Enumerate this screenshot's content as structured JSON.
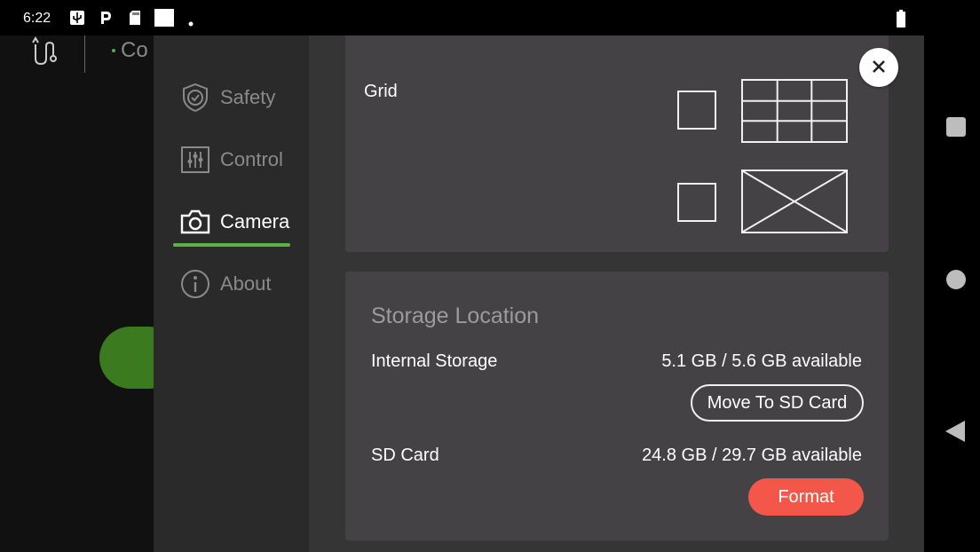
{
  "status_bar": {
    "time": "6:22",
    "icons": [
      "usb-icon",
      "parking-icon",
      "sd-card-icon",
      "notification-square-icon",
      "dot-icon"
    ],
    "battery_icon": "battery-icon"
  },
  "app": {
    "logo_icon": "app-logo-icon",
    "header_label": "Co",
    "accent_color": "#5cb345"
  },
  "sidebar": {
    "items": [
      {
        "label": "Safety",
        "icon": "shield-check-icon",
        "active": false
      },
      {
        "label": "Control",
        "icon": "sliders-icon",
        "active": false
      },
      {
        "label": "Camera",
        "icon": "camera-icon",
        "active": true
      },
      {
        "label": "About",
        "icon": "info-icon",
        "active": false
      }
    ]
  },
  "grid": {
    "title": "Grid",
    "options": [
      {
        "preview": "grid-3x3-preview",
        "checked": false
      },
      {
        "preview": "diagonal-cross-preview",
        "checked": false
      }
    ]
  },
  "storage": {
    "title": "Storage Location",
    "internal_label": "Internal Storage",
    "internal_value": "5.1 GB / 5.6 GB available",
    "move_button": "Move To SD Card",
    "sd_label": "SD Card",
    "sd_value": "24.8 GB / 29.7 GB available",
    "format_button": "Format",
    "format_color": "#f2574a"
  },
  "close_icon": "close-icon",
  "system_nav": {
    "recents": "recents-square-icon",
    "home": "home-circle-icon",
    "back": "back-triangle-icon"
  }
}
